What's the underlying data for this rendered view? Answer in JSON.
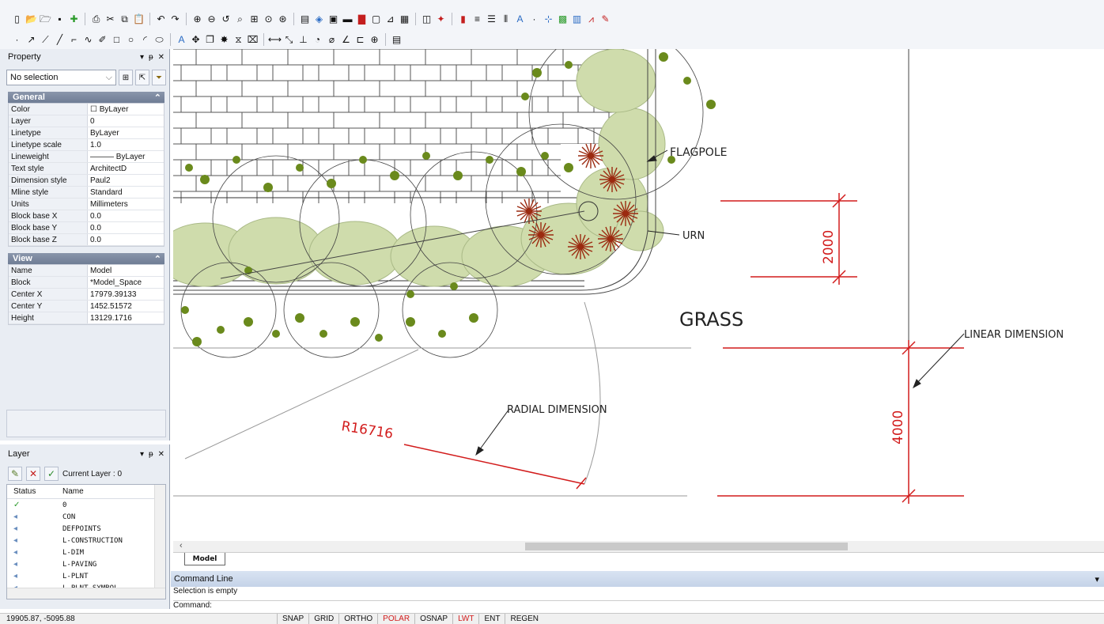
{
  "toolbar1": {
    "icons": [
      "new-icon",
      "open-icon",
      "open-folder-icon",
      "save-icon",
      "add-icon",
      "print-icon",
      "cut-icon",
      "copy-icon",
      "paste-icon",
      "undo-icon",
      "redo-icon",
      "zoom-in-icon",
      "zoom-out-icon",
      "zoom-previous-icon",
      "zoom-window-icon",
      "zoom-extents-icon",
      "zoom-all-icon",
      "zoom-realtime-icon",
      "properties-icon",
      "layer-icon",
      "block-icon",
      "hatch-icon",
      "red-book-icon",
      "image-icon",
      "dimension-icon",
      "table-icon",
      "frame-icon",
      "settings-icon",
      "color-bars-icon",
      "lineweight-icon",
      "linetype-icon",
      "column-icon",
      "text-style-icon",
      "point-icon",
      "insert-icon",
      "grid-icon",
      "library-icon",
      "chart-icon",
      "markup-icon"
    ]
  },
  "toolbar2": {
    "icons": [
      "point-icon",
      "ray-icon",
      "xline-icon",
      "line-icon",
      "polyline-icon",
      "spline-icon",
      "pencil-icon",
      "rectangle-icon",
      "circle-icon",
      "arc-icon",
      "ellipse-icon",
      "text-icon",
      "move-icon",
      "copy-object-icon",
      "explode-icon",
      "mirror-icon",
      "trim-icon",
      "dim-linear-icon",
      "dim-aligned-icon",
      "dim-ordinate-icon",
      "dim-radius-icon",
      "dim-diameter-icon",
      "dim-angular-icon",
      "dim-baseline-icon",
      "dim-center-icon",
      "dim-style-icon"
    ]
  },
  "property": {
    "title": "Property",
    "pin": "▾ ᵽ ✕",
    "selection": "No selection",
    "general_title": "General",
    "general": [
      {
        "k": "Color",
        "v": "☐ ByLayer"
      },
      {
        "k": "Layer",
        "v": "0"
      },
      {
        "k": "Linetype",
        "v": "ByLayer"
      },
      {
        "k": "Linetype scale",
        "v": "1.0"
      },
      {
        "k": "Lineweight",
        "v": "——— ByLayer"
      },
      {
        "k": "Text style",
        "v": "ArchitectD"
      },
      {
        "k": "Dimension style",
        "v": "Paul2"
      },
      {
        "k": "Mline style",
        "v": "Standard"
      },
      {
        "k": "Units",
        "v": "Millimeters"
      },
      {
        "k": "Block base X",
        "v": "0.0"
      },
      {
        "k": "Block base Y",
        "v": "0.0"
      },
      {
        "k": "Block base Z",
        "v": "0.0"
      }
    ],
    "view_title": "View",
    "view": [
      {
        "k": "Name",
        "v": "Model"
      },
      {
        "k": "Block",
        "v": "*Model_Space"
      },
      {
        "k": "Center X",
        "v": "17979.39133"
      },
      {
        "k": "Center Y",
        "v": "1452.51572"
      },
      {
        "k": "Height",
        "v": "13129.1716"
      }
    ]
  },
  "layer": {
    "title": "Layer",
    "current_label": "Current Layer : 0",
    "col_status": "Status",
    "col_name": "Name",
    "rows": [
      {
        "status": "✓",
        "name": "0"
      },
      {
        "status": "◂",
        "name": "CON"
      },
      {
        "status": "◂",
        "name": "DEFPOINTS"
      },
      {
        "status": "◂",
        "name": "L-CONSTRUCTION"
      },
      {
        "status": "◂",
        "name": "L-DIM"
      },
      {
        "status": "◂",
        "name": "L-PAVING"
      },
      {
        "status": "◂",
        "name": "L-PLNT"
      },
      {
        "status": "◂",
        "name": "L-PLNT-SYMBOL"
      }
    ]
  },
  "drawing": {
    "labels": {
      "flagpole": "FLAGPOLE",
      "urn": "URN",
      "grass": "GRASS",
      "linear": "LINEAR DIMENSION",
      "radial": "RADIAL DIMENSION",
      "radius_value": "R16716",
      "dim_2000": "2000",
      "dim_4000": "4000"
    },
    "colors": {
      "dim": "#d21c1c",
      "foliage": "#cfdcac",
      "tree": "#6a8a1c",
      "flower": "#9b2a10"
    }
  },
  "tabs": {
    "model": "Model"
  },
  "command": {
    "title": "Command Line",
    "line1": "Selection is empty",
    "line2": "Command:"
  },
  "status": {
    "coords": "19905.87, -5095.88",
    "buttons": [
      {
        "label": "SNAP",
        "on": false
      },
      {
        "label": "GRID",
        "on": false
      },
      {
        "label": "ORTHO",
        "on": false
      },
      {
        "label": "POLAR",
        "on": true
      },
      {
        "label": "OSNAP",
        "on": false
      },
      {
        "label": "LWT",
        "on": true
      },
      {
        "label": "ENT",
        "on": false
      },
      {
        "label": "REGEN",
        "on": false
      }
    ]
  }
}
